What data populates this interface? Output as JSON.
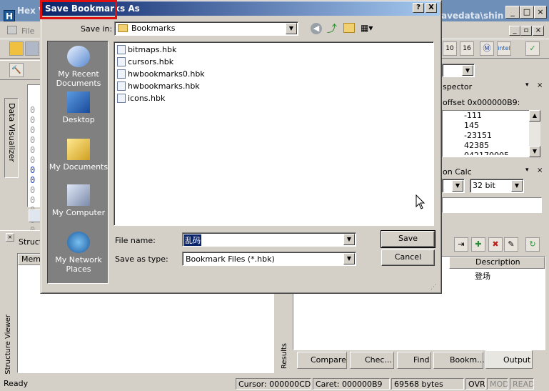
{
  "app": {
    "title_left": "Hex V",
    "title_right": "avedata\\shin",
    "menu_file": "File",
    "icon_letter": "H"
  },
  "inspector": {
    "title": "spector",
    "offset": "offset 0x000000B9:",
    "values": [
      "-111",
      "145",
      "-23151",
      "42385",
      "042170005"
    ]
  },
  "base_conv": {
    "title": "on Calc",
    "bits": "32 bit"
  },
  "left_panel": {
    "hex_rows": [
      "0 0",
      "0 0",
      "0 0",
      "0 0",
      "0 0",
      "0 0",
      "0 0"
    ],
    "side_tab": "Data Visualizer"
  },
  "structure": {
    "title": "Structu",
    "col_member": "Memb",
    "side_tab": "Structure Viewer"
  },
  "results": {
    "side_tab": "Results",
    "col_desc": "Description",
    "row_text": "登场",
    "tabs": [
      "Compare",
      "Chec...",
      "Find",
      "Bookm...",
      "Output"
    ]
  },
  "statusbar": {
    "ready": "Ready",
    "cursor": "Cursor: 000000CD",
    "caret": "Caret: 000000B9",
    "size": "69568 bytes",
    "ovr": "OVR",
    "mod": "MOD",
    "read": "READ"
  },
  "dialog": {
    "title": "Save Bookmarks As",
    "save_in_label": "Save in:",
    "save_in_value": "Bookmarks",
    "places": [
      "My Recent Documents",
      "Desktop",
      "My Documents",
      "My Computer",
      "My Network Places"
    ],
    "files": [
      "bitmaps.hbk",
      "cursors.hbk",
      "hwbookmarks0.hbk",
      "hwbookmarks.hbk",
      "icons.hbk"
    ],
    "file_name_label": "File name:",
    "file_name_value": "乱码",
    "save_as_type_label": "Save as type:",
    "save_as_type_value": "Bookmark Files (*.hbk)",
    "save_button": "Save",
    "cancel_button": "Cancel",
    "help_button": "?",
    "close_button": "X"
  },
  "colors": {
    "title_gradient_start": "#0a246a",
    "title_gradient_end": "#a6caf0",
    "highlight_box": "#e01010",
    "places_bg": "#808080"
  }
}
